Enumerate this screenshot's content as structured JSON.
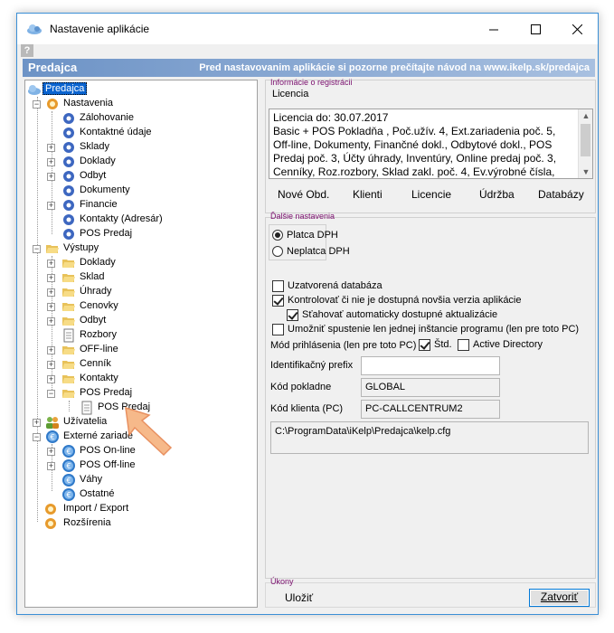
{
  "window": {
    "title": "Nastavenie aplikácie",
    "help": "?"
  },
  "banner": {
    "left": "Predajca",
    "right": "Pred nastavovanim aplikácie si pozorne prečítajte návod na www.ikelp.sk/predajca"
  },
  "tree": {
    "root": "Predajca",
    "nastavenia": "Nastavenia",
    "zalohovanie": "Zálohovanie",
    "kontaktne_udaje": "Kontaktné údaje",
    "sklady": "Sklady",
    "doklady": "Doklady",
    "odbyt": "Odbyt",
    "dokumenty": "Dokumenty",
    "financie": "Financie",
    "kontakty_adresar": "Kontakty (Adresár)",
    "pos_predaj_n": "POS Predaj",
    "vystupy": "Výstupy",
    "v_doklady": "Doklady",
    "v_sklad": "Sklad",
    "v_uhrady": "Úhrady",
    "v_cenovky": "Cenovky",
    "v_odbyt": "Odbyt",
    "v_rozbory": "Rozbory",
    "v_offline": "OFF-line",
    "v_cennik": "Cenník",
    "v_kontakty": "Kontakty",
    "v_pos_predaj": "POS Predaj",
    "v_pos_predaj_child": "POS Predaj",
    "uzivatelia": "Užívatelia",
    "externe": "Externé zariade",
    "pos_online": "POS On-line",
    "pos_offline": "POS Off-line",
    "vahy": "Váhy",
    "ostatne": "Ostatné",
    "import_export": "Import / Export",
    "rozsirenia": "Rozšírenia"
  },
  "registration": {
    "section_title": "Informácie o registrácii",
    "licence_label": "Licencia",
    "text_lines": [
      "Licencia do: 30.07.2017",
      "Basic + POS Pokladňa , Poč.užív. 4, Ext.zariadenia poč. 5,",
      "Off-line, Dokumenty, Finančné dokl., Odbytové dokl., POS",
      "Predaj poč. 3, Účty úhrady, Inventúry, Online predaj poč. 3,",
      "Cenníky, Roz.rozbory, Sklad zakl. poč. 4, Ev.výrobné čísla,"
    ],
    "buttons": {
      "nove_obd": "Nové Obd.",
      "klienti": "Klienti",
      "licencie": "Licencie",
      "udrzba": "Údržba",
      "databazy": "Databázy"
    }
  },
  "other": {
    "section_title": "Ďalšie nastavenia",
    "platca": "Platca DPH",
    "neplatca": "Neplatca DPH",
    "uzatvorena": "Uzatvorená databáza",
    "kontrolovat": "Kontrolovať či nie je dostupná novšia verzia aplikácie",
    "stahovat": "Sťahovať automaticky dostupné aktualizácie",
    "umoznit": "Umožniť spustenie len jednej inštancie programu (len pre toto PC)",
    "mod_label": "Mód prihlásenia (len pre toto PC)",
    "std": "Štd.",
    "active_directory": "Active Directory",
    "prefix_label": "Identifikačný prefix",
    "prefix_value": "",
    "kod_pokladne_label": "Kód pokladne",
    "kod_pokladne_value": "GLOBAL",
    "kod_klienta_label": "Kód klienta (PC)",
    "kod_klienta_value": "PC-CALLCENTRUM2",
    "config_path": "C:\\ProgramData\\iKelp\\Predajca\\kelp.cfg"
  },
  "actions": {
    "section_title": "Úkony",
    "save": "Uložiť",
    "close": "Zatvoriť"
  },
  "colors": {
    "accent": "#0a64d0",
    "banner": "#6d93c6",
    "section_title": "#7a0d6d",
    "arrow": "#f6b98a"
  }
}
